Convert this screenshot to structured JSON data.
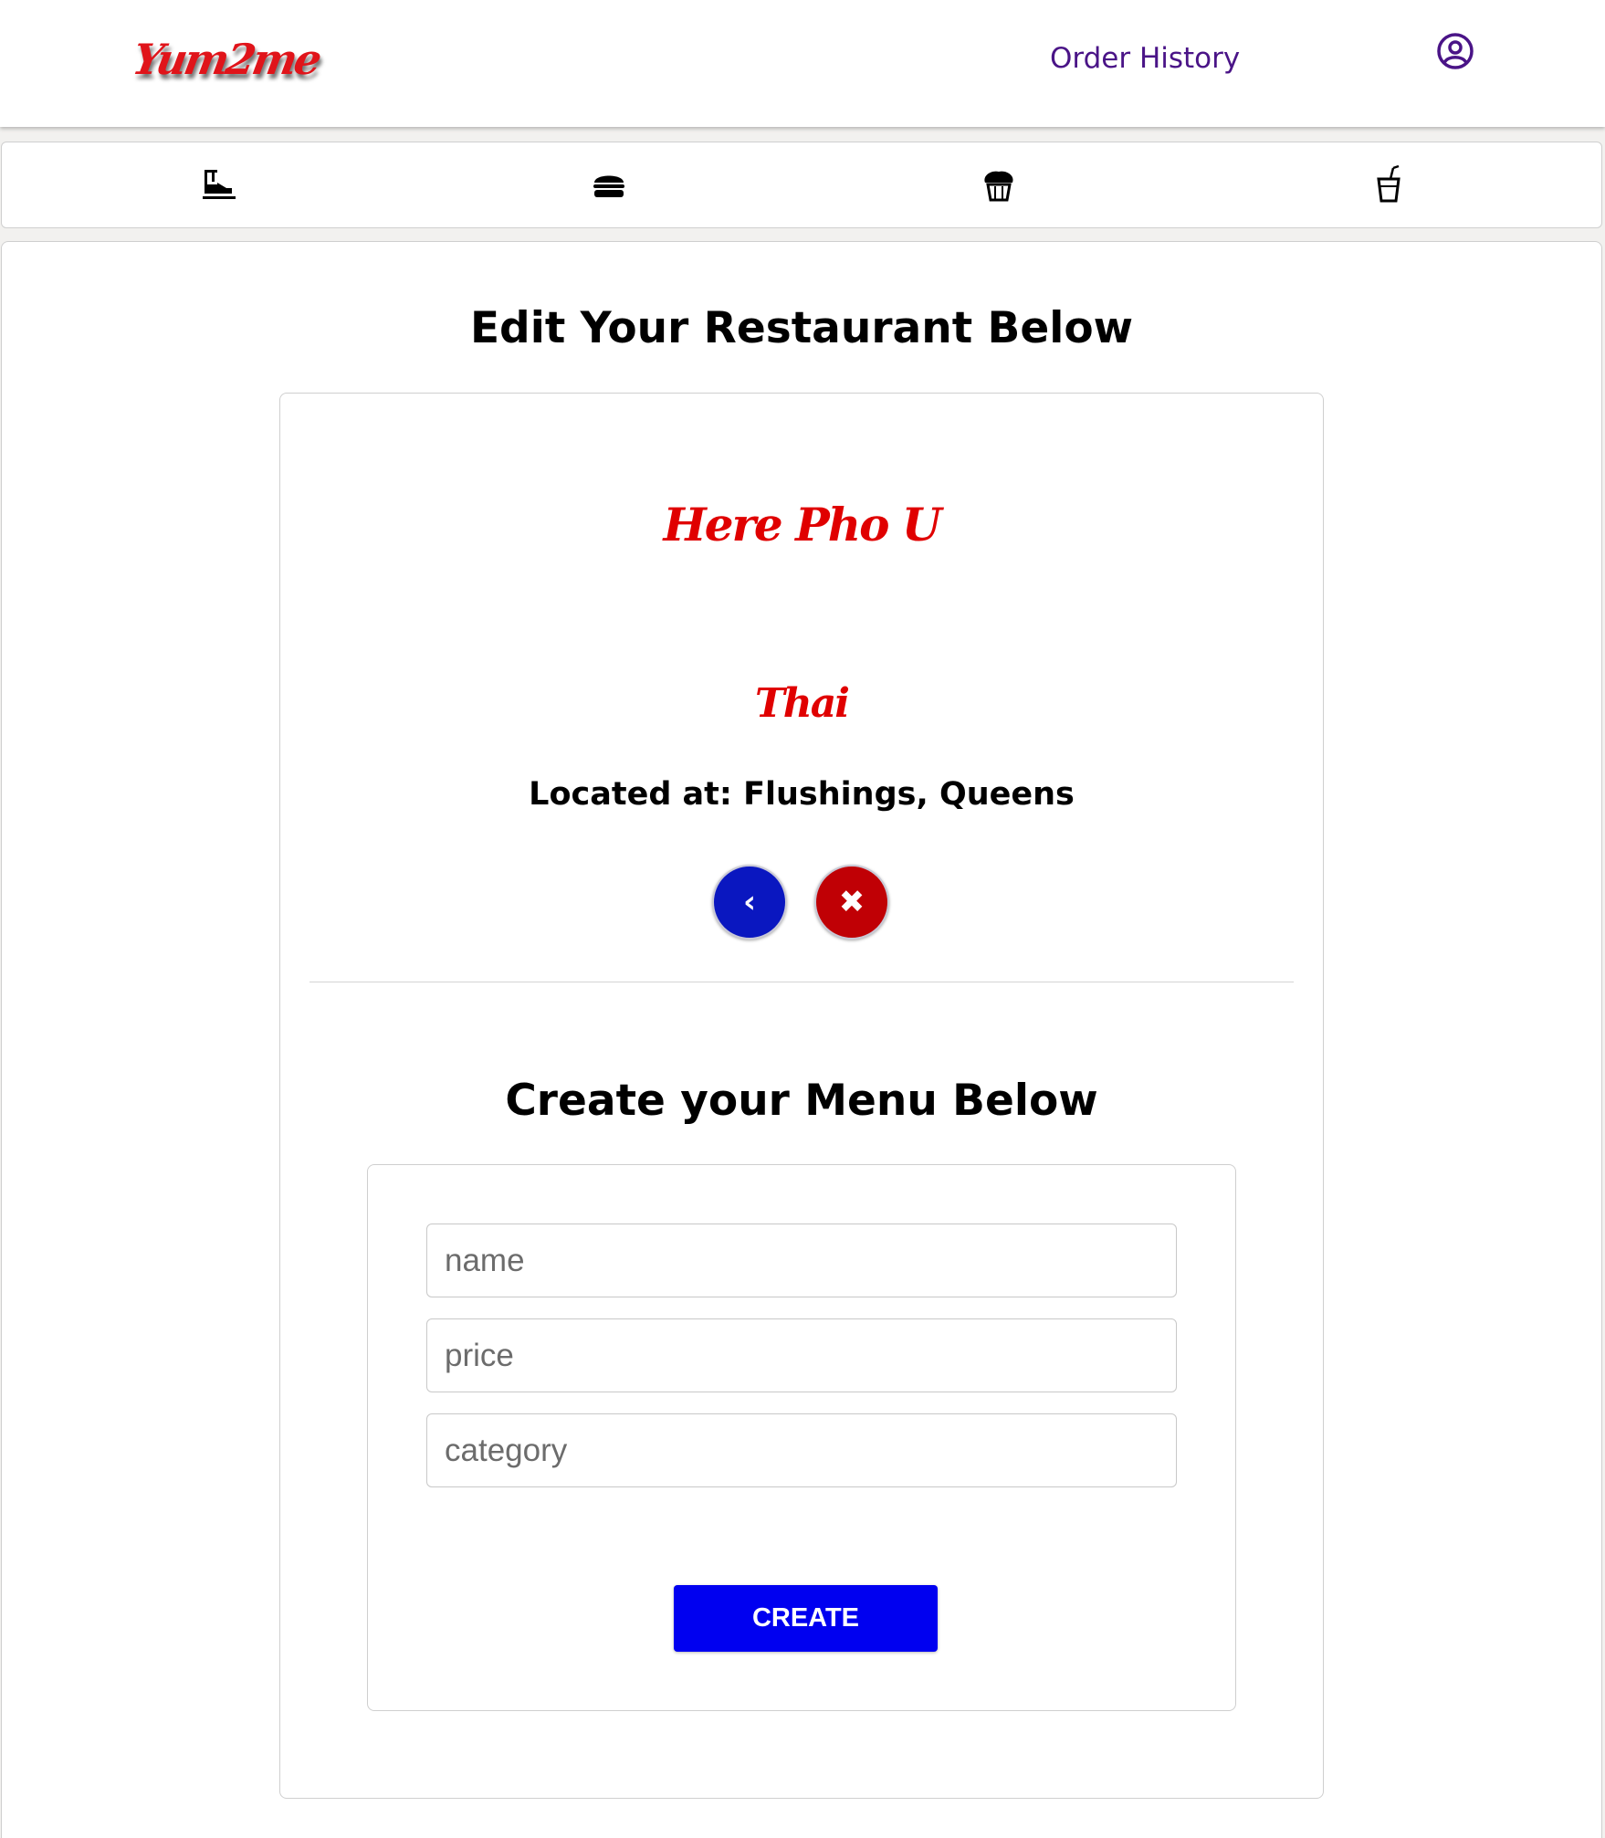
{
  "header": {
    "brand": "Yum2me",
    "order_history_label": "Order History",
    "user_icon": "user-circle-icon"
  },
  "categories": [
    {
      "icon": "noodle-bowl-icon"
    },
    {
      "icon": "burger-icon"
    },
    {
      "icon": "cupcake-icon"
    },
    {
      "icon": "drink-cup-icon"
    }
  ],
  "edit_section": {
    "title": "Edit Your Restaurant Below",
    "restaurant_name": "Here Pho U",
    "cuisine": "Thai",
    "location": "Located at: Flushings, Queens",
    "back_button_label": "‹",
    "delete_button_label": "✖"
  },
  "menu_section": {
    "title": "Create your Menu Below",
    "name_placeholder": "name",
    "price_placeholder": "price",
    "category_placeholder": "category",
    "create_button_label": "CREATE"
  },
  "colors": {
    "brand_red": "#e0141a",
    "nav_purple": "#4a1487",
    "back_blue": "#0a17c0",
    "delete_red": "#c00005",
    "create_blue": "#0000f0"
  }
}
